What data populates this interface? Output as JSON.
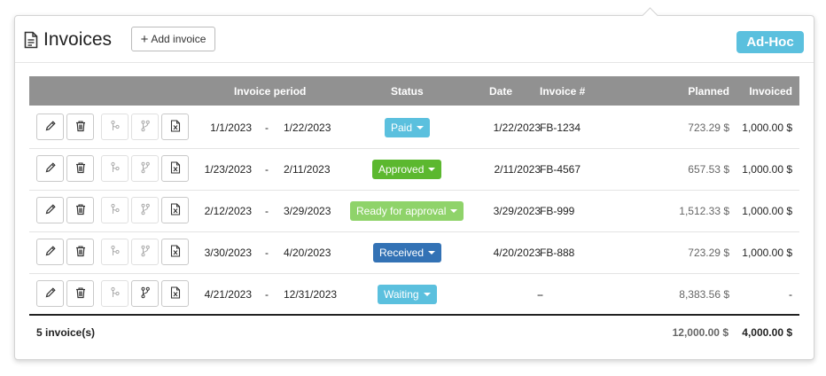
{
  "header": {
    "title": "Invoices",
    "add_button_label": "Add invoice",
    "badge": "Ad-Hoc",
    "badge_color": "#5bc0de"
  },
  "table": {
    "columns": {
      "period": "Invoice period",
      "status": "Status",
      "date": "Date",
      "invoice_no": "Invoice #",
      "planned": "Planned",
      "invoiced": "Invoiced"
    },
    "rows": [
      {
        "start": "1/1/2023",
        "sep": "-",
        "end": "1/22/2023",
        "status": "Paid",
        "status_color": "#5bc0de",
        "date": "1/22/2023",
        "invoice_no": "FB-1234",
        "planned": "723.29 $",
        "invoiced": "1,000.00 $",
        "branch_active": false
      },
      {
        "start": "1/23/2023",
        "sep": "-",
        "end": "2/11/2023",
        "status": "Approved",
        "status_color": "#5cb82f",
        "date": "2/11/2023",
        "invoice_no": "FB-4567",
        "planned": "657.53 $",
        "invoiced": "1,000.00 $",
        "branch_active": false
      },
      {
        "start": "2/12/2023",
        "sep": "-",
        "end": "3/29/2023",
        "status": "Ready for approval",
        "status_color": "#8fd36a",
        "date": "3/29/2023",
        "invoice_no": "FB-999",
        "planned": "1,512.33 $",
        "invoiced": "1,000.00 $",
        "branch_active": false
      },
      {
        "start": "3/30/2023",
        "sep": "-",
        "end": "4/20/2023",
        "status": "Received",
        "status_color": "#3372b5",
        "date": "4/20/2023",
        "invoice_no": "FB-888",
        "planned": "723.29 $",
        "invoiced": "1,000.00 $",
        "branch_active": false
      },
      {
        "start": "4/21/2023",
        "sep": "-",
        "end": "12/31/2023",
        "status": "Waiting",
        "status_color": "#5bc0de",
        "date": "-",
        "invoice_no": "-",
        "planned": "8,383.56 $",
        "invoiced": "-",
        "branch_active": true
      }
    ]
  },
  "footer": {
    "count": "5 invoice(s)",
    "planned_total": "12,000.00 $",
    "invoiced_total": "4,000.00 $"
  },
  "icons": [
    "document-icon",
    "edit-icon",
    "delete-icon",
    "commit-icon",
    "branch-icon",
    "excel-file-icon"
  ]
}
